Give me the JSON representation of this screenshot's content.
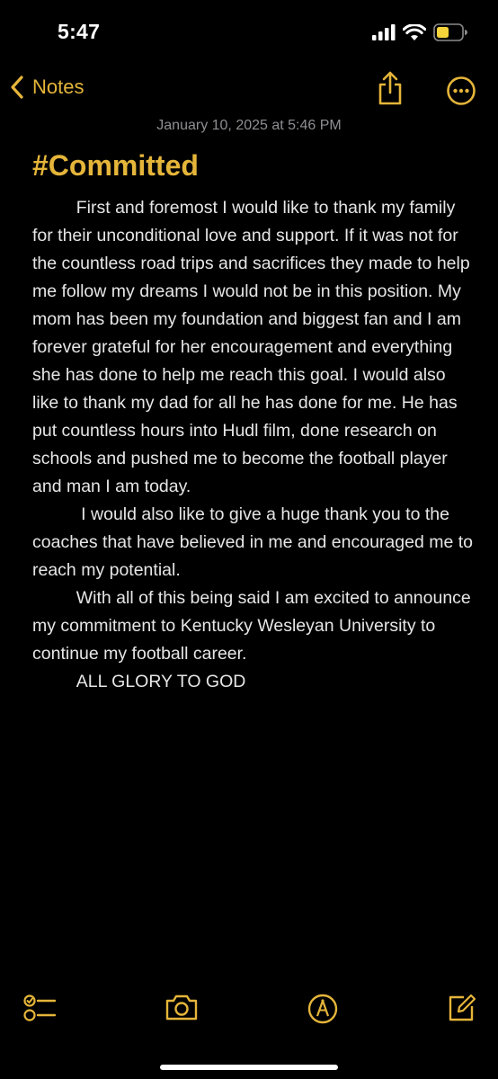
{
  "status_bar": {
    "time": "5:47",
    "battery_color": "#f5d33a"
  },
  "nav": {
    "back_label": "Notes",
    "accent_color": "#e5b53a",
    "icons": [
      "chevron-left-icon",
      "share-icon",
      "more-icon"
    ]
  },
  "note": {
    "date": "January 10, 2025 at 5:46 PM",
    "title": "#Committed",
    "paragraphs": [
      "         First and foremost I would like to thank my family for their unconditional love and support. If it was not for the countless road trips and sacrifices they made to help me follow my dreams I would not be in this position. My mom has been my foundation and biggest fan and I am forever grateful for her encouragement and everything she has done to help me reach this goal. I would also like to thank my dad for all he has done for me. He has put countless hours into Hudl film, done research on schools and pushed me to become the football player and man I am today.",
      "          I would also like to give a huge thank you to the coaches that have believed in me and encouraged me to reach my potential.",
      "         With all of this being said I am excited to announce my commitment to Kentucky Wesleyan University to continue my football career.",
      "         ALL GLORY TO GOD"
    ]
  },
  "toolbar": {
    "icons": [
      "checklist-icon",
      "camera-icon",
      "markup-icon",
      "compose-icon"
    ]
  }
}
